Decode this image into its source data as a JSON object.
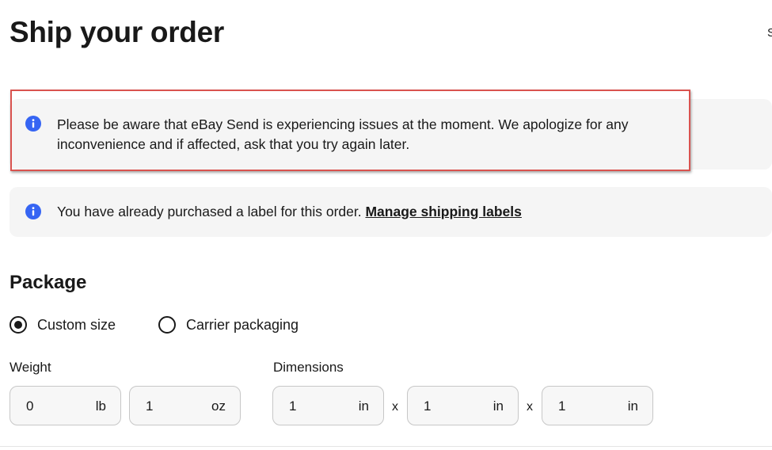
{
  "page": {
    "title": "Ship your order",
    "edge_text": "S"
  },
  "notices": [
    {
      "icon": "info-icon",
      "text": "Please be aware that eBay Send is experiencing issues at the moment. We apologize for any inconvenience and if affected, ask that you try again later."
    },
    {
      "icon": "info-icon",
      "text": "You have already purchased a label for this order. ",
      "link": "Manage shipping labels"
    }
  ],
  "package": {
    "title": "Package",
    "options": [
      {
        "label": "Custom size",
        "selected": true
      },
      {
        "label": "Carrier packaging",
        "selected": false
      }
    ]
  },
  "weight": {
    "label": "Weight",
    "fields": [
      {
        "value": "0",
        "unit": "lb"
      },
      {
        "value": "1",
        "unit": "oz"
      }
    ]
  },
  "dimensions": {
    "label": "Dimensions",
    "separator": "x",
    "fields": [
      {
        "value": "1",
        "unit": "in"
      },
      {
        "value": "1",
        "unit": "in"
      },
      {
        "value": "1",
        "unit": "in"
      }
    ]
  },
  "colors": {
    "info_blue": "#3665f3",
    "highlight_red": "#d9534f",
    "notice_bg": "#f5f5f5"
  }
}
